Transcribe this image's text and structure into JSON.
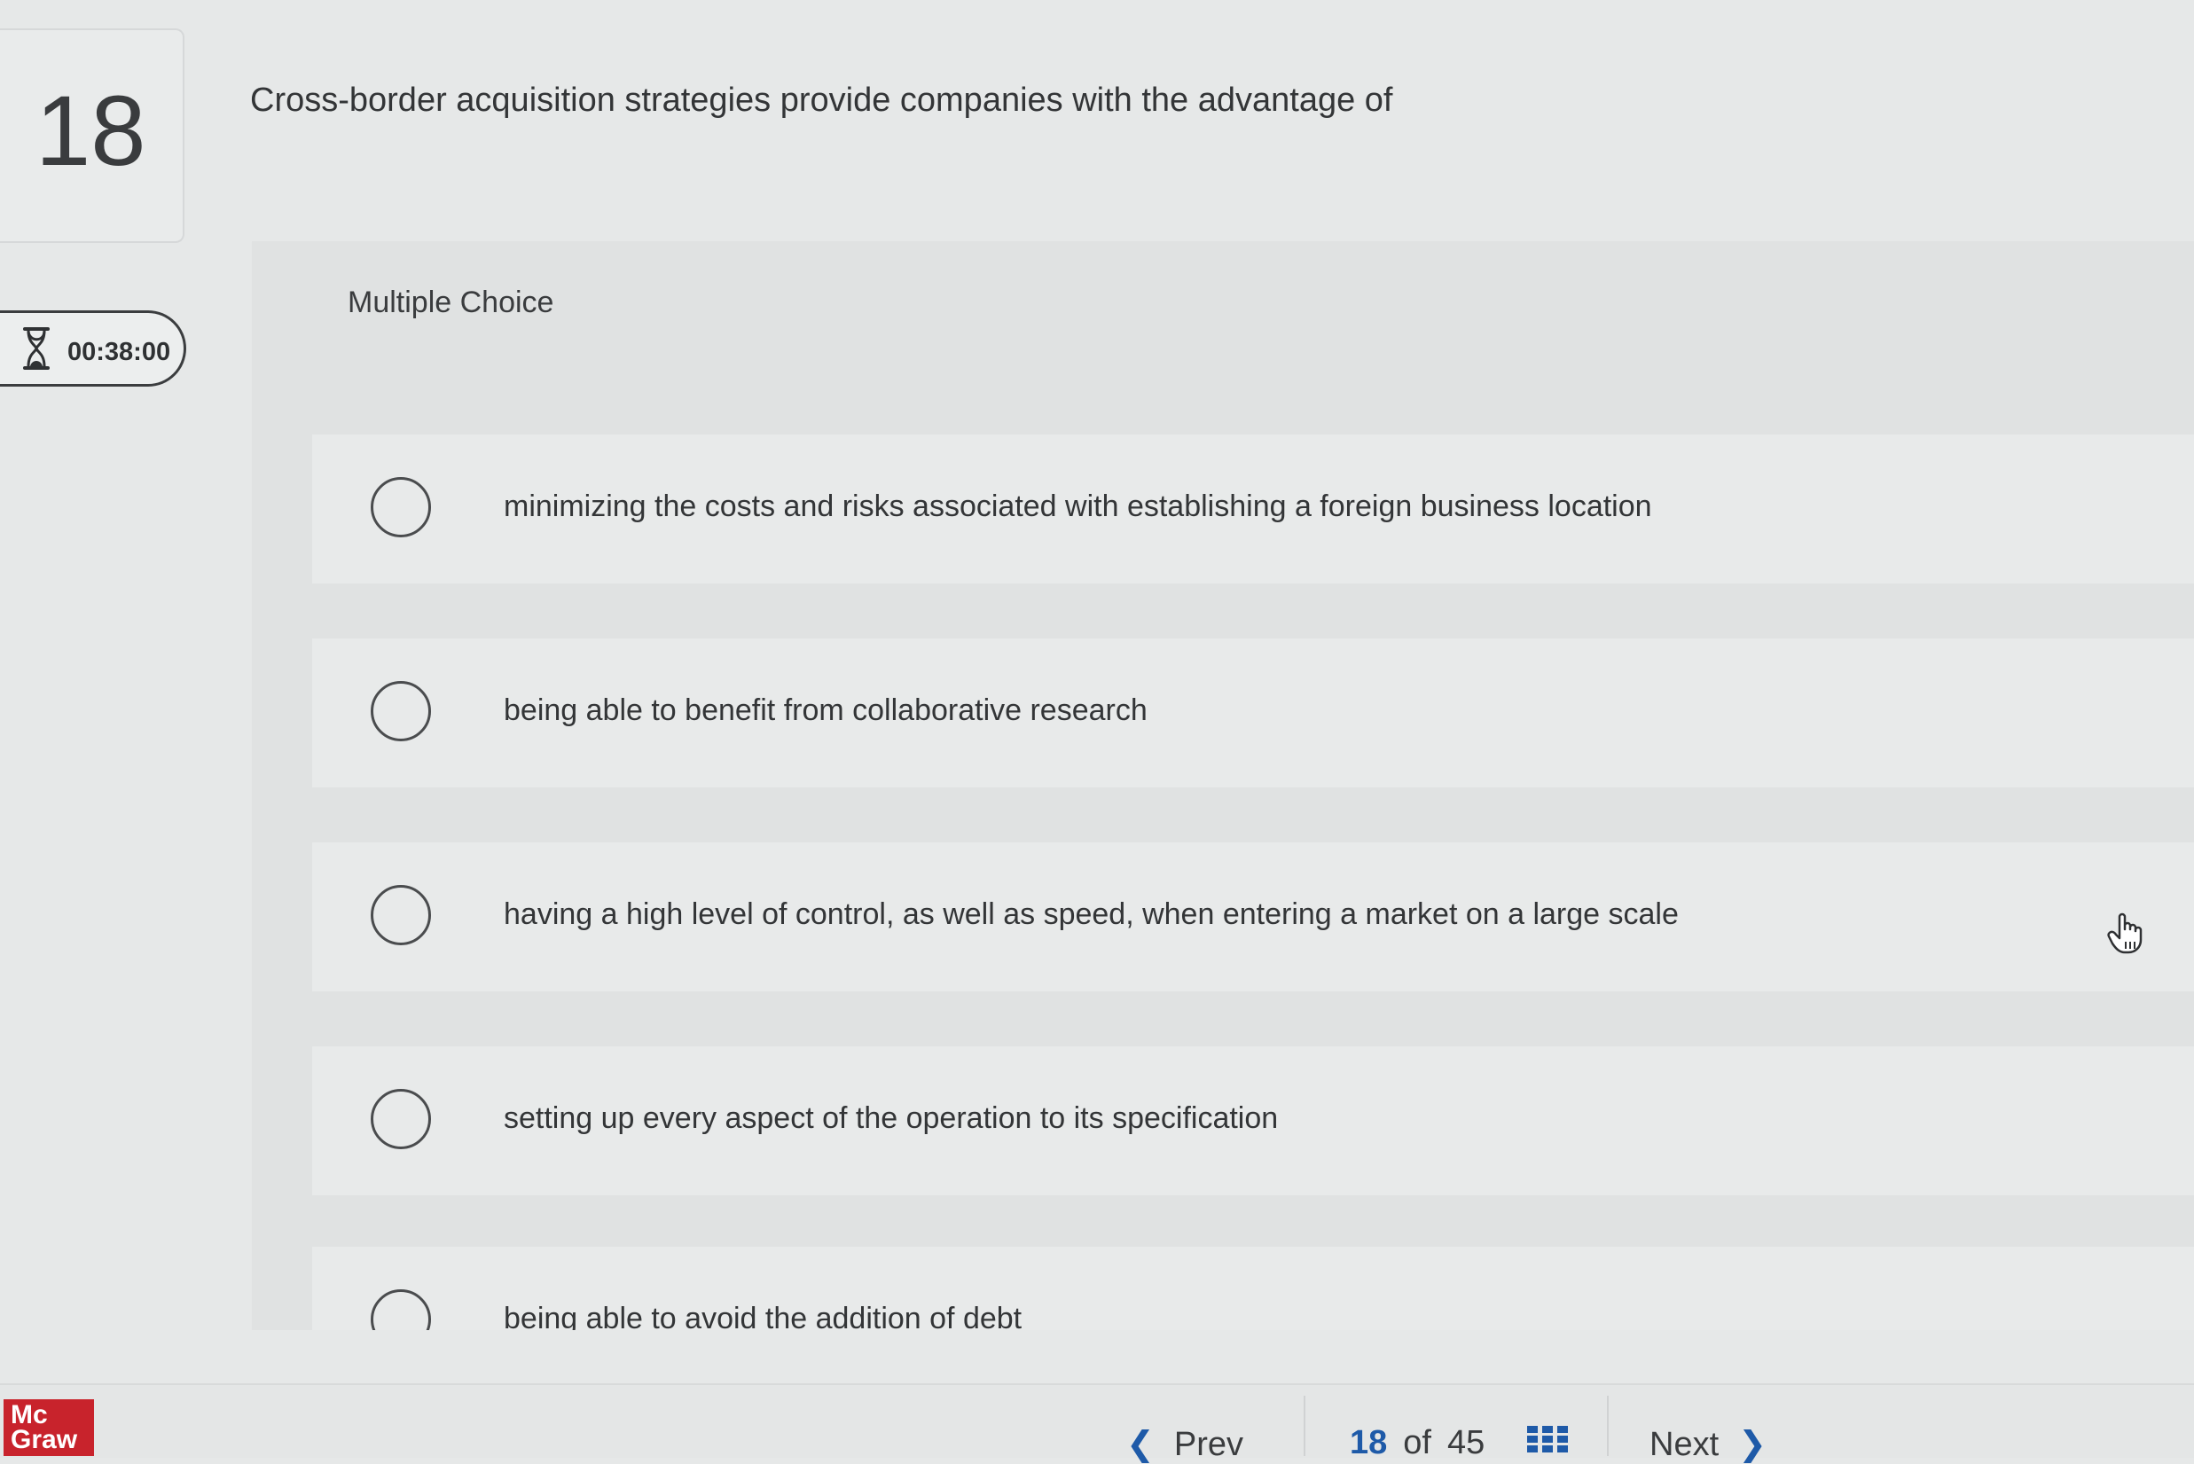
{
  "question": {
    "number": "18",
    "text": "Cross-border acquisition strategies provide companies with the advantage of",
    "type_label": "Multiple Choice"
  },
  "timer": {
    "icon": "hourglass-icon",
    "time": "00:38:00"
  },
  "options": [
    {
      "label": "minimizing the costs and risks associated with establishing a foreign business location",
      "selected": false
    },
    {
      "label": "being able to benefit from collaborative research",
      "selected": false
    },
    {
      "label": "having a high level of control, as well as speed, when entering a market on a large scale",
      "selected": false
    },
    {
      "label": "setting up every aspect of the operation to its specification",
      "selected": false
    },
    {
      "label": "being able to avoid the addition of debt",
      "selected": false
    }
  ],
  "footer": {
    "logo_line1": "Mc",
    "logo_line2": "Graw",
    "prev_label": "Prev",
    "next_label": "Next",
    "current_page": "18",
    "of_label": "of",
    "total_pages": "45",
    "grid_icon": "grid-icon"
  },
  "colors": {
    "accent": "#1e5aa8",
    "brand": "#c8232c"
  }
}
